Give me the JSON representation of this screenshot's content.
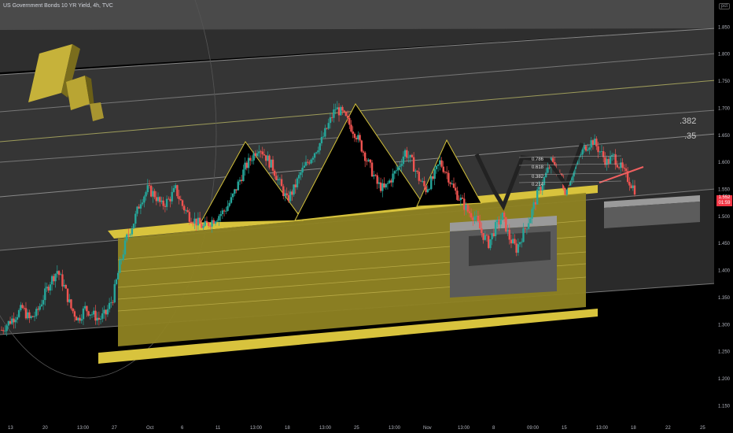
{
  "header": {
    "symbol_text": "US Government Bonds 10 YR Yield, 4h, TVC"
  },
  "price_axis": {
    "unit": "pct",
    "current_price": "1.552",
    "countdown": "01:59"
  },
  "level_labels": [
    ".382",
    ".35"
  ],
  "fib_labels": [
    "0.786",
    "0.618",
    "0.382",
    "0.214"
  ],
  "chart_data": {
    "type": "candlestick",
    "title": "US Government Bonds 10 YR Yield, 4h, TVC",
    "xlabel": "",
    "ylabel": "",
    "ylim": [
      1.12,
      1.9
    ],
    "y_ticks": [
      1.15,
      1.2,
      1.25,
      1.3,
      1.35,
      1.4,
      1.45,
      1.5,
      1.55,
      1.6,
      1.65,
      1.7,
      1.75,
      1.8,
      1.85
    ],
    "x_ticks": [
      "13",
      "20",
      "13:00",
      "27",
      "Oct",
      "6",
      "11",
      "13:00",
      "18",
      "13:00",
      "25",
      "13:00",
      "Nov",
      "13:00",
      "8",
      "09:00",
      "15",
      "13:00",
      "18",
      "22",
      "25"
    ],
    "close_path": [
      [
        0,
        1.29
      ],
      [
        3,
        1.31
      ],
      [
        6,
        1.33
      ],
      [
        8,
        1.31
      ],
      [
        10,
        1.32
      ],
      [
        12,
        1.35
      ],
      [
        14,
        1.38
      ],
      [
        16,
        1.4
      ],
      [
        18,
        1.37
      ],
      [
        20,
        1.33
      ],
      [
        22,
        1.31
      ],
      [
        24,
        1.33
      ],
      [
        26,
        1.32
      ],
      [
        28,
        1.31
      ],
      [
        30,
        1.32
      ],
      [
        32,
        1.35
      ],
      [
        34,
        1.41
      ],
      [
        36,
        1.46
      ],
      [
        38,
        1.49
      ],
      [
        40,
        1.53
      ],
      [
        42,
        1.55
      ],
      [
        44,
        1.54
      ],
      [
        46,
        1.52
      ],
      [
        48,
        1.53
      ],
      [
        50,
        1.55
      ],
      [
        52,
        1.52
      ],
      [
        54,
        1.5
      ],
      [
        56,
        1.49
      ],
      [
        58,
        1.48
      ],
      [
        60,
        1.49
      ],
      [
        62,
        1.5
      ],
      [
        64,
        1.51
      ],
      [
        66,
        1.53
      ],
      [
        68,
        1.56
      ],
      [
        70,
        1.59
      ],
      [
        72,
        1.61
      ],
      [
        74,
        1.63
      ],
      [
        76,
        1.61
      ],
      [
        78,
        1.59
      ],
      [
        80,
        1.56
      ],
      [
        82,
        1.53
      ],
      [
        84,
        1.55
      ],
      [
        86,
        1.58
      ],
      [
        88,
        1.6
      ],
      [
        90,
        1.62
      ],
      [
        92,
        1.64
      ],
      [
        94,
        1.67
      ],
      [
        96,
        1.7
      ],
      [
        98,
        1.69
      ],
      [
        100,
        1.67
      ],
      [
        102,
        1.65
      ],
      [
        104,
        1.62
      ],
      [
        106,
        1.59
      ],
      [
        108,
        1.56
      ],
      [
        110,
        1.55
      ],
      [
        112,
        1.57
      ],
      [
        114,
        1.59
      ],
      [
        116,
        1.62
      ],
      [
        118,
        1.6
      ],
      [
        120,
        1.57
      ],
      [
        122,
        1.55
      ],
      [
        124,
        1.57
      ],
      [
        126,
        1.6
      ],
      [
        128,
        1.58
      ],
      [
        130,
        1.55
      ],
      [
        132,
        1.53
      ],
      [
        134,
        1.51
      ],
      [
        136,
        1.5
      ],
      [
        138,
        1.47
      ],
      [
        140,
        1.45
      ],
      [
        142,
        1.48
      ],
      [
        144,
        1.5
      ],
      [
        146,
        1.46
      ],
      [
        148,
        1.44
      ],
      [
        150,
        1.47
      ],
      [
        152,
        1.5
      ],
      [
        154,
        1.54
      ],
      [
        156,
        1.57
      ],
      [
        158,
        1.6
      ],
      [
        160,
        1.58
      ],
      [
        162,
        1.55
      ],
      [
        164,
        1.58
      ],
      [
        166,
        1.61
      ],
      [
        168,
        1.63
      ],
      [
        170,
        1.64
      ],
      [
        172,
        1.62
      ],
      [
        174,
        1.6
      ],
      [
        176,
        1.61
      ],
      [
        178,
        1.59
      ],
      [
        180,
        1.57
      ],
      [
        182,
        1.55
      ]
    ],
    "levels": [
      {
        "label": ".382",
        "value": 1.665
      },
      {
        "label": ".35",
        "value": 1.638
      }
    ],
    "annotations": [
      "0.786",
      "0.618",
      "0.382",
      "0.214"
    ]
  },
  "colors": {
    "bull": "#26a69a",
    "bear": "#ef5350",
    "gold": "#d4c13a",
    "gold_dark": "#6f6518",
    "band_grey": "#3d3d3d",
    "band_light": "#5e5e5e",
    "axis_text": "#b2b5be",
    "price_tag": "#f23645"
  }
}
